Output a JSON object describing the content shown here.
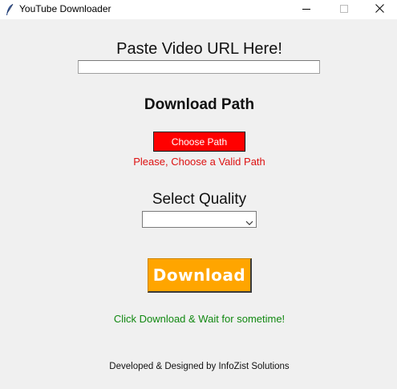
{
  "window": {
    "title": "YouTube Downloader",
    "icon": "feather-icon",
    "controls": [
      "minimize-icon",
      "maximize-icon",
      "close-icon"
    ]
  },
  "url_section": {
    "label": "Paste Video URL Here!",
    "input_value": "",
    "placeholder": ""
  },
  "path_section": {
    "label": "Download Path",
    "button_label": "Choose Path",
    "button_color": "#ff0000",
    "error_text": "Please, Choose a Valid Path",
    "error_color": "#dd1111"
  },
  "quality_section": {
    "label": "Select Quality",
    "selected_value": ""
  },
  "download": {
    "button_label": "Download",
    "button_color": "#ffa500",
    "status_text": "Click Download & Wait for sometime!",
    "status_color": "#118811"
  },
  "footer": {
    "text": "Developed & Designed by InfoZist Solutions"
  }
}
